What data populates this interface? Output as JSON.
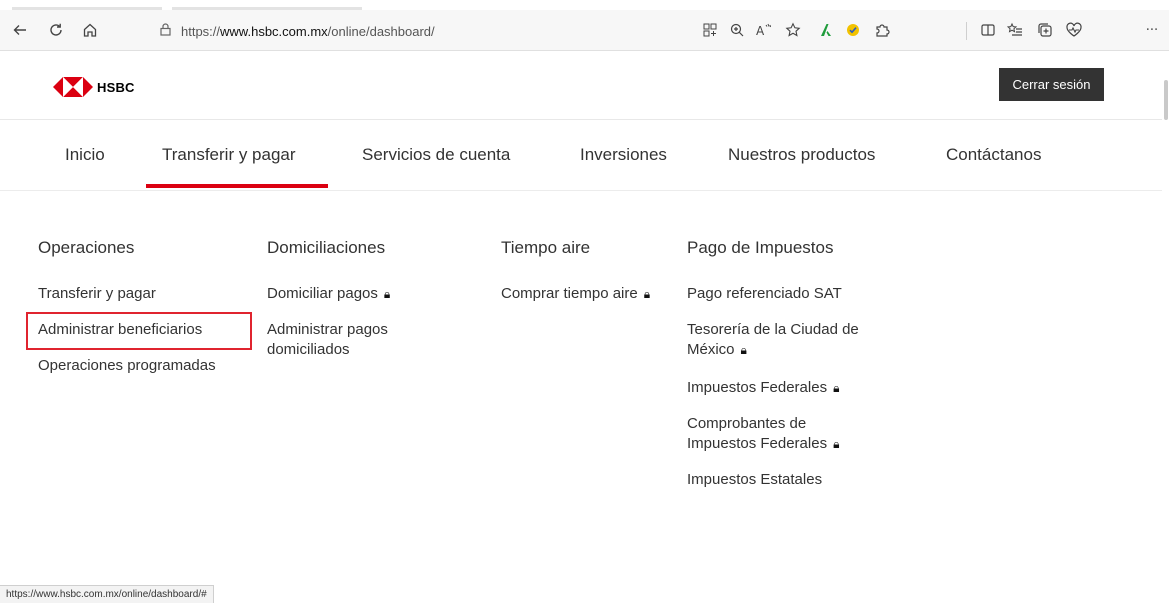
{
  "browser": {
    "url_prefix": "https://",
    "url_domain": "www.hsbc.com.mx",
    "url_path": "/online/dashboard/",
    "status_url": "https://www.hsbc.com.mx/online/dashboard/#",
    "more_label": "···"
  },
  "header": {
    "logo_text": "HSBC",
    "logout_label": "Cerrar sesión",
    "brand_color": "#db0011"
  },
  "nav": {
    "items": [
      {
        "label": "Inicio"
      },
      {
        "label": "Transferir y pagar",
        "active": true
      },
      {
        "label": "Servicios de cuenta"
      },
      {
        "label": "Inversiones"
      },
      {
        "label": "Nuestros productos"
      },
      {
        "label": "Contáctanos"
      }
    ]
  },
  "menu": {
    "columns": [
      {
        "title": "Operaciones",
        "links": [
          {
            "label": "Transferir y pagar"
          },
          {
            "label": "Administrar beneficiarios",
            "highlighted": true
          },
          {
            "label": "Operaciones programadas"
          }
        ]
      },
      {
        "title": "Domiciliaciones",
        "links": [
          {
            "label": "Domiciliar pagos",
            "locked": true
          },
          {
            "label_line1": "Administrar pagos",
            "label_line2": "domiciliados"
          }
        ]
      },
      {
        "title": "Tiempo aire",
        "links": [
          {
            "label": "Comprar tiempo aire",
            "locked": true
          }
        ]
      },
      {
        "title": "Pago de Impuestos",
        "links": [
          {
            "label": "Pago referenciado SAT"
          },
          {
            "label_line1": "Tesorería de la Ciudad de",
            "label_line2": "México",
            "locked": true
          },
          {
            "label": "Impuestos Federales",
            "locked": true
          },
          {
            "label_line1": "Comprobantes de",
            "label_line2": "Impuestos Federales",
            "locked": true
          },
          {
            "label": "Impuestos Estatales"
          }
        ]
      }
    ]
  },
  "icons": {
    "back": "back-arrow-icon",
    "refresh": "refresh-icon",
    "home": "home-icon",
    "lock": "lock-icon",
    "grid": "app-grid-icon",
    "zoom": "zoom-icon",
    "read_aloud": "read-aloud-icon",
    "favorite": "star-icon",
    "ext1": "extension-a-icon",
    "ext2": "extension-check-icon",
    "extensions": "puzzle-icon",
    "split": "split-screen-icon",
    "favorites_bar": "favorites-list-icon",
    "collections": "collections-icon",
    "health": "browser-essentials-icon",
    "more": "more-icon"
  }
}
